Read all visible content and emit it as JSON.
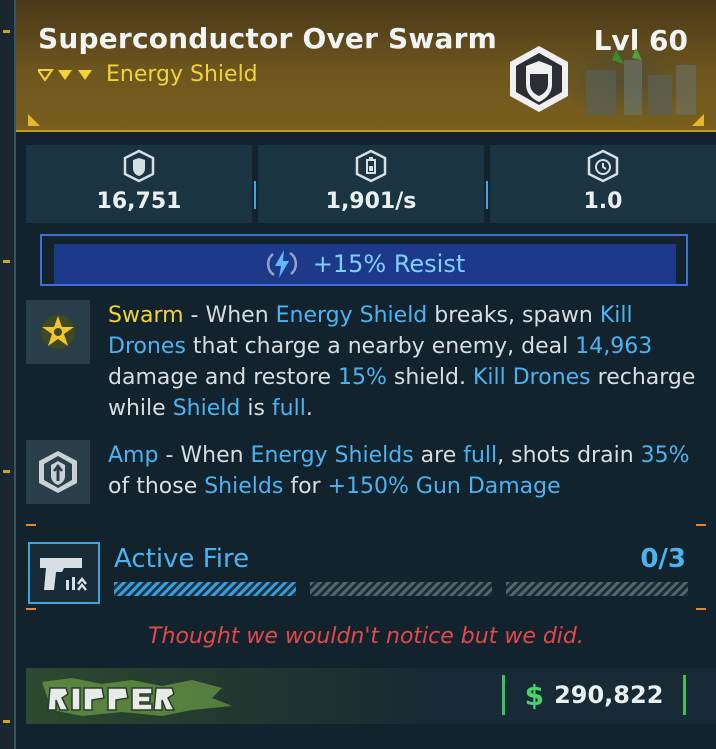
{
  "item": {
    "name": "Superconductor Over Swarm",
    "level": "Lvl 60",
    "type": "Energy Shield",
    "rarity_color": "#f2d33a",
    "icon": "shield-emblem-icon"
  },
  "stats": [
    {
      "icon": "shield-capacity-icon",
      "value": "16,751"
    },
    {
      "icon": "recharge-rate-icon",
      "value": "1,901/s"
    },
    {
      "icon": "recharge-delay-icon",
      "value": "1.0"
    }
  ],
  "resist": {
    "icon": "lightning-icon",
    "text": "+15% Resist"
  },
  "perks": [
    {
      "icon": "star-icon",
      "name": "Swarm",
      "parts": [
        " - When ",
        "Energy Shield",
        " breaks, spawn ",
        "Kill Drones",
        " that charge a nearby enemy, deal ",
        "14,963",
        " damage and restore ",
        "15%",
        " shield. ",
        "Kill Drones",
        " recharge while ",
        "Shield",
        " is ",
        "full",
        "."
      ]
    },
    {
      "icon": "amp-shield-icon",
      "name": "Amp",
      "parts": [
        " - When ",
        "Energy Shields",
        " are ",
        "full",
        ", shots drain ",
        "35%",
        " of those ",
        "Shields",
        " for ",
        "+150% Gun Damage"
      ]
    }
  ],
  "active_fire": {
    "icon": "pistol-icon",
    "label": "Active Fire",
    "count": "0/3",
    "progress_filled_segments": 1,
    "segments": 3
  },
  "flavor_text": "Thought we wouldn't notice but we did.",
  "manufacturer": {
    "name": "ripper",
    "logo": "ripper-logo"
  },
  "price": {
    "currency": "$",
    "amount": "290,822"
  },
  "colors": {
    "accent_blue": "#4bb3f2",
    "accent_yellow": "#f2d33a",
    "flavor_red": "#e14a4a",
    "price_green": "#48d36a"
  }
}
